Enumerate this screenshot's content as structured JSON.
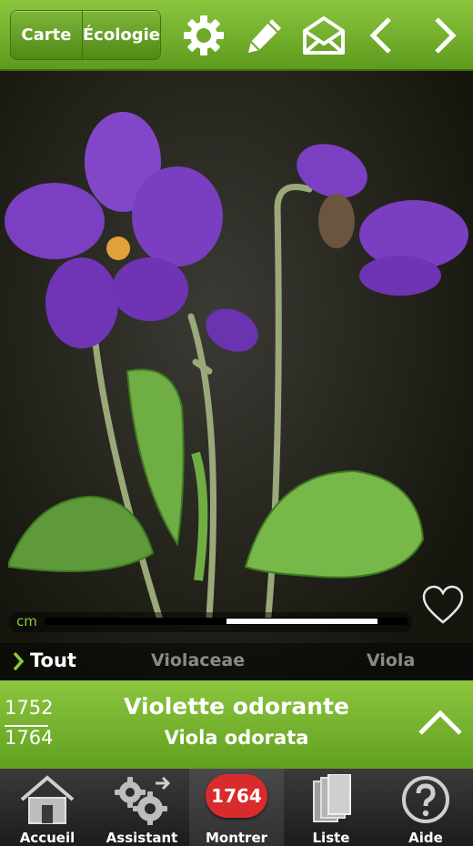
{
  "toolbar": {
    "segment_map": "Carte",
    "segment_ecology": "Écologie",
    "icons": [
      "gear-icon",
      "pencil-icon",
      "mail-icon",
      "chevron-left-icon",
      "chevron-right-icon"
    ]
  },
  "photo": {
    "scale_unit": "cm"
  },
  "taxonomy": {
    "all_label": "Tout",
    "family": "Violaceae",
    "genus": "Viola"
  },
  "species": {
    "index": "1752",
    "total": "1764",
    "common_name": "Violette odorante",
    "latin_name": "Viola odorata"
  },
  "tabs": [
    {
      "label": "Accueil",
      "icon": "home-icon"
    },
    {
      "label": "Assistant",
      "icon": "gears-icon"
    },
    {
      "label": "Montrer",
      "badge": "1764"
    },
    {
      "label": "Liste",
      "icon": "books-icon"
    },
    {
      "label": "Aide",
      "icon": "help-icon"
    }
  ],
  "colors": {
    "accent_green": "#7cb82f",
    "badge_red": "#d92b2b",
    "flower_purple": "#7b3fc2"
  }
}
